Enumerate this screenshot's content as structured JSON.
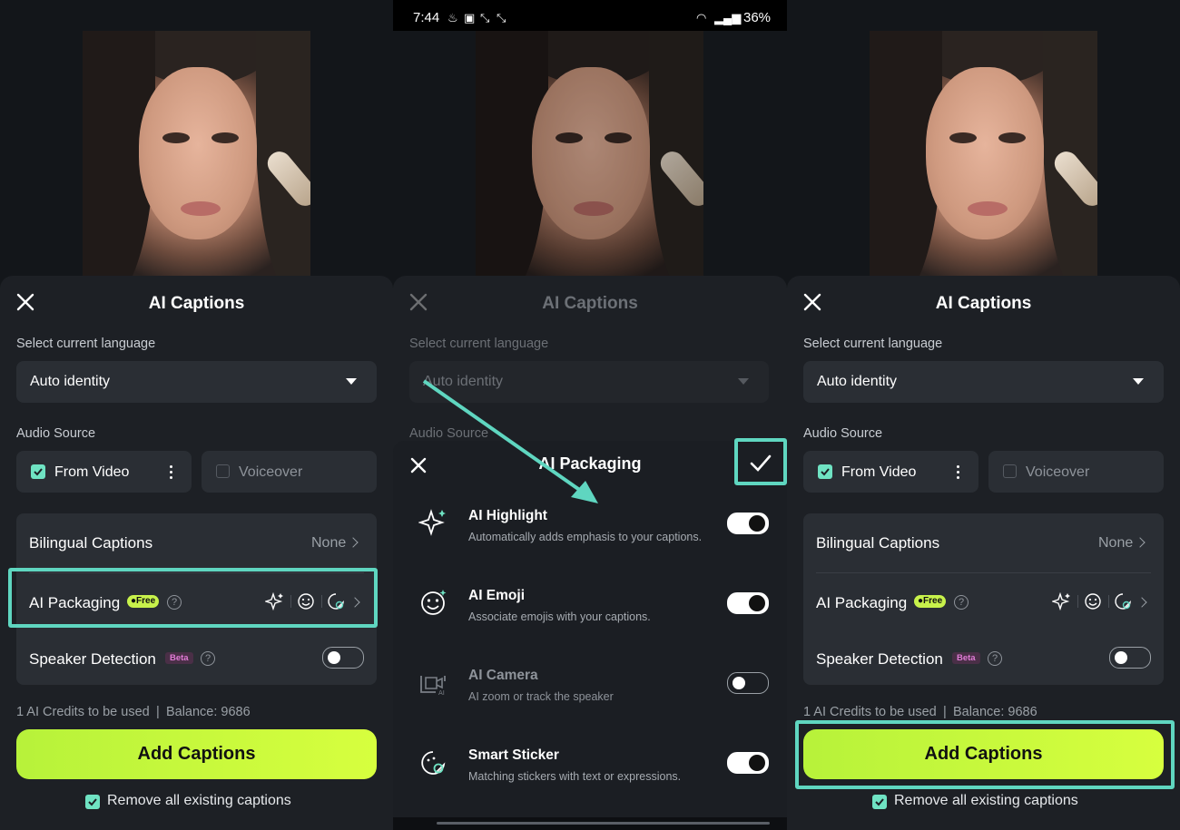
{
  "status_bar": {
    "time": "7:44",
    "battery": "36%"
  },
  "panel1": {
    "title": "AI Captions",
    "language_label": "Select current language",
    "language_value": "Auto identity",
    "audio_label": "Audio Source",
    "source_video": "From Video",
    "source_voiceover": "Voiceover",
    "bilingual_label": "Bilingual Captions",
    "bilingual_value": "None",
    "packaging_label": "AI Packaging",
    "free_badge": "Free",
    "speaker_label": "Speaker Detection",
    "beta_badge": "Beta",
    "credits": "1 AI Credits to be used | Balance: 9686",
    "add_button": "Add Captions",
    "remove_label": "Remove all existing captions"
  },
  "panel2": {
    "title": "AI Captions",
    "language_label": "Select current language",
    "language_value": "Auto identity",
    "audio_label": "Audio Source",
    "sheet_title": "AI Packaging",
    "features": [
      {
        "title": "AI Highlight",
        "desc": "Automatically adds emphasis to your captions.",
        "enabled": true
      },
      {
        "title": "AI Emoji",
        "desc": "Associate emojis with your captions.",
        "enabled": true
      },
      {
        "title": "AI Camera",
        "desc": "AI zoom or track the speaker",
        "enabled": false
      },
      {
        "title": "Smart Sticker",
        "desc": "Matching stickers with text or expressions.",
        "enabled": true
      }
    ]
  },
  "panel3": {
    "title": "AI Captions",
    "language_label": "Select current language",
    "language_value": "Auto identity",
    "audio_label": "Audio Source",
    "source_video": "From Video",
    "source_voiceover": "Voiceover",
    "bilingual_label": "Bilingual Captions",
    "bilingual_value": "None",
    "packaging_label": "AI Packaging",
    "free_badge": "Free",
    "speaker_label": "Speaker Detection",
    "beta_badge": "Beta",
    "credits": "1 AI Credits to be used | Balance: 9686",
    "add_button": "Add Captions",
    "remove_label": "Remove all existing captions"
  },
  "colors": {
    "accent": "#c8f24b",
    "highlight": "#5fd6c0",
    "teal_check": "#6fe3c3",
    "sheet_bg": "#1d2025"
  },
  "icons": [
    "close-icon",
    "caret-down-icon",
    "check-icon",
    "kebab-icon",
    "chevron-right-icon",
    "sparkle-icon",
    "emoji-icon",
    "sticker-icon",
    "camera-icon",
    "question-icon"
  ]
}
